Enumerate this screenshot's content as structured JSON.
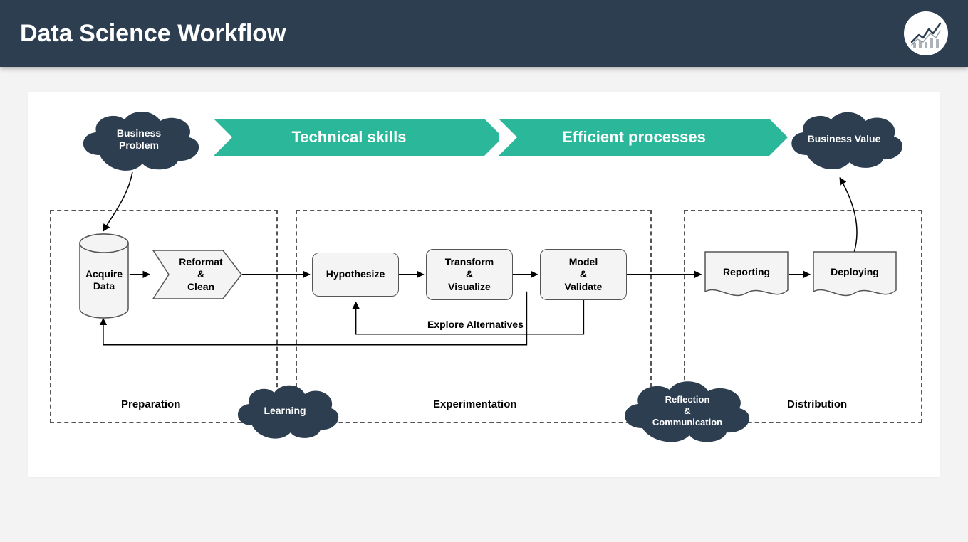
{
  "header": {
    "title": "Data Science Workflow"
  },
  "banners": {
    "technical": "Technical skills",
    "processes": "Efficient processes"
  },
  "clouds": {
    "business_problem": "Business\nProblem",
    "business_value": "Business Value",
    "learning": "Learning",
    "reflection": "Reflection\n&\nCommunication"
  },
  "nodes": {
    "acquire": "Acquire\nData",
    "reformat": "Reformat\n&\nClean",
    "hypothesize": "Hypothesize",
    "transform": "Transform\n&\nVisualize",
    "model": "Model\n&\nValidate",
    "reporting": "Reporting",
    "deploying": "Deploying"
  },
  "labels": {
    "explore": "Explore Alternatives",
    "preparation": "Preparation",
    "experimentation": "Experimentation",
    "distribution": "Distribution"
  }
}
